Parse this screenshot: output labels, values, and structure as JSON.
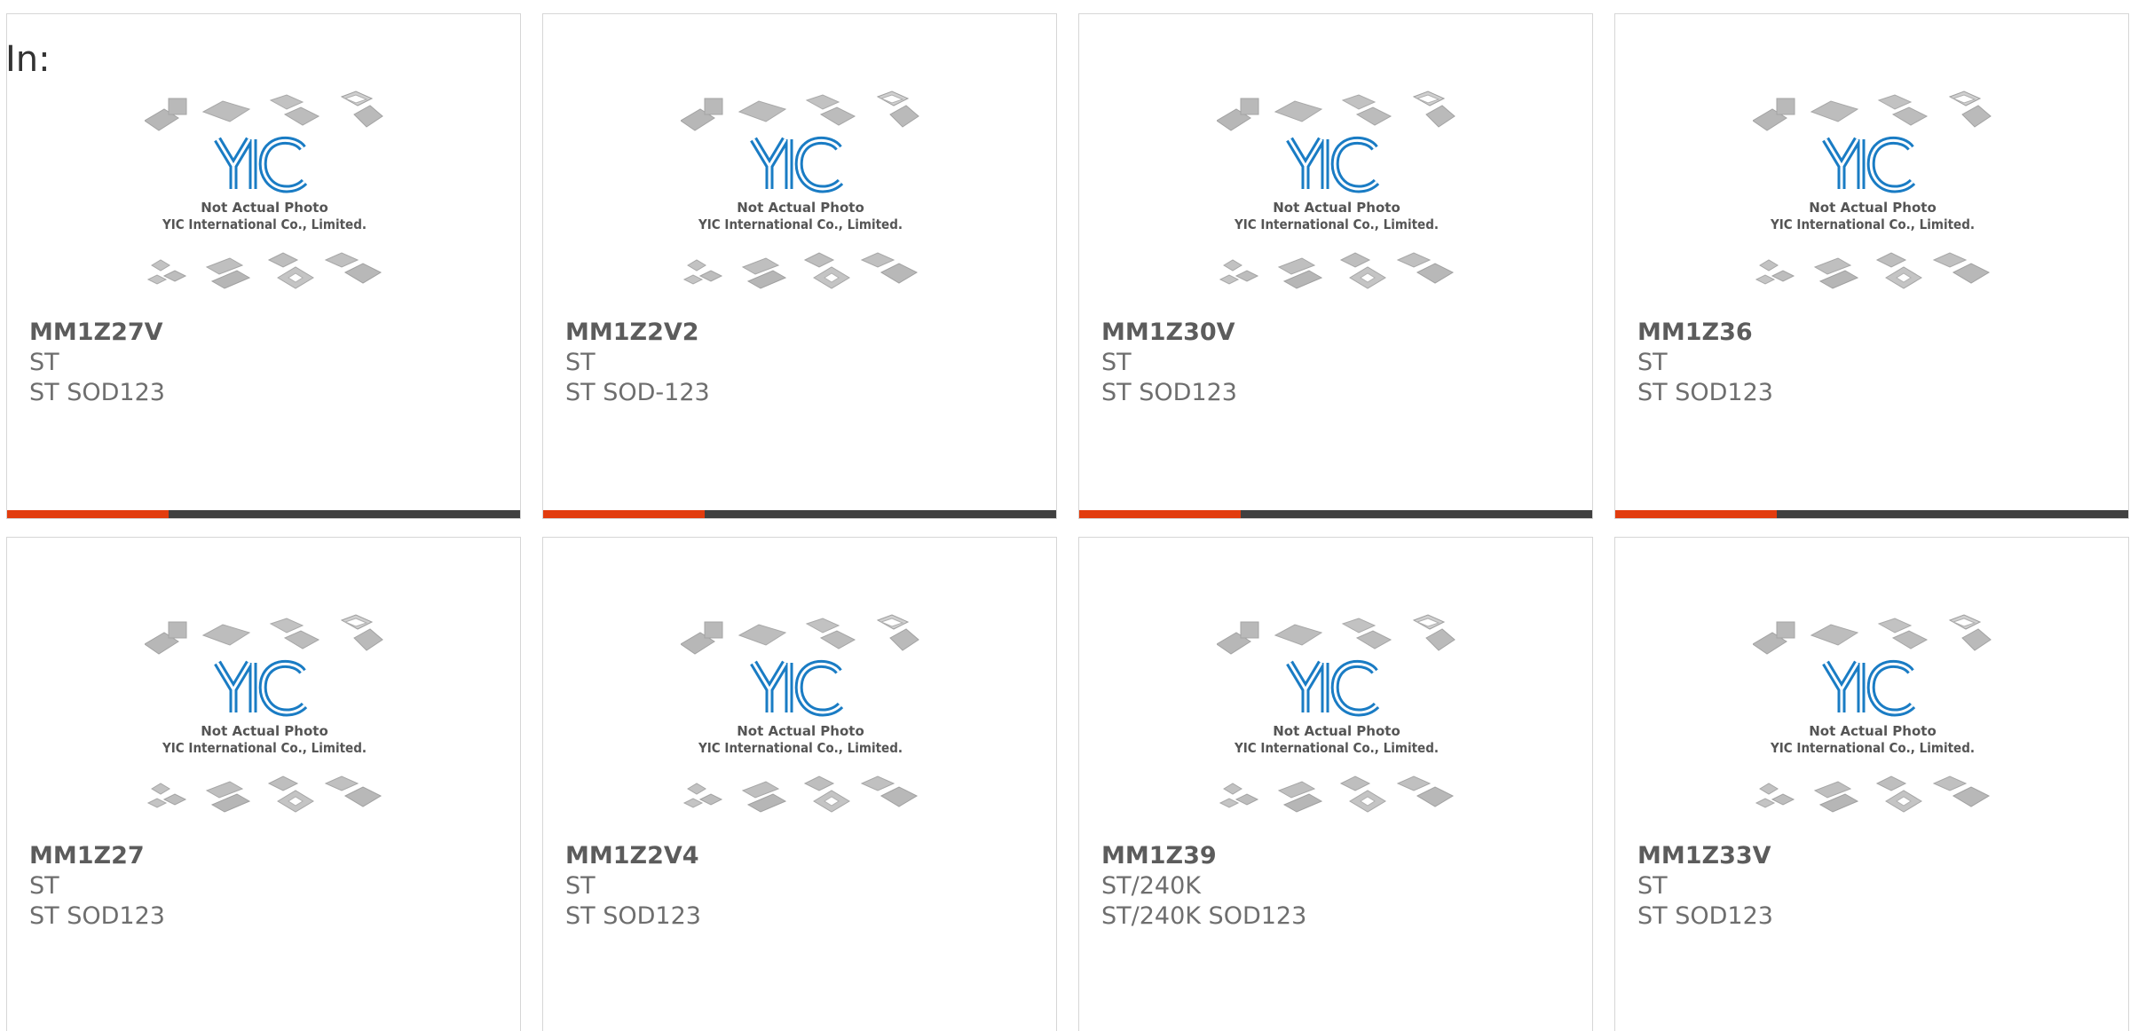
{
  "header": {
    "in_label": "In:"
  },
  "photo": {
    "caption_line1": "Not Actual Photo",
    "caption_line2": "YIC International Co., Limited.",
    "logo_text": "YIC"
  },
  "colors": {
    "accent": "#e23c0e",
    "bar": "#404040",
    "text": "#6e6e6e",
    "logo": "#1a7cc4"
  },
  "products": [
    {
      "part": "MM1Z27V",
      "brand": "ST",
      "package": "ST SOD123"
    },
    {
      "part": "MM1Z2V2",
      "brand": "ST",
      "package": "ST SOD-123"
    },
    {
      "part": "MM1Z30V",
      "brand": "ST",
      "package": "ST SOD123"
    },
    {
      "part": "MM1Z36",
      "brand": "ST",
      "package": "ST SOD123"
    },
    {
      "part": "MM1Z27",
      "brand": "ST",
      "package": "ST SOD123"
    },
    {
      "part": "MM1Z2V4",
      "brand": "ST",
      "package": "ST SOD123"
    },
    {
      "part": "MM1Z39",
      "brand": "ST/240K",
      "package": "ST/240K SOD123"
    },
    {
      "part": "MM1Z33V",
      "brand": "ST",
      "package": "ST SOD123"
    }
  ]
}
